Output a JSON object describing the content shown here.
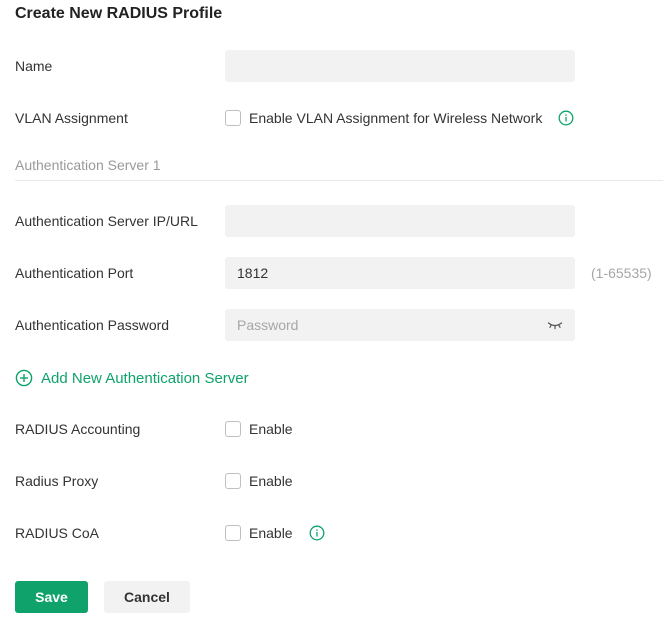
{
  "page": {
    "title": "Create New RADIUS Profile"
  },
  "form": {
    "name": {
      "label": "Name",
      "value": ""
    },
    "vlan": {
      "label": "VLAN Assignment",
      "checkbox_label": "Enable VLAN Assignment for Wireless Network",
      "checked": false
    },
    "section_title": "Authentication Server 1",
    "auth_ip": {
      "label": "Authentication Server IP/URL",
      "value": ""
    },
    "auth_port": {
      "label": "Authentication Port",
      "value": "1812",
      "range_hint": "(1-65535)"
    },
    "auth_password": {
      "label": "Authentication Password",
      "value": "",
      "placeholder": "Password"
    },
    "add_server": {
      "label": "Add New Authentication Server"
    },
    "accounting": {
      "label": "RADIUS Accounting",
      "checkbox_label": "Enable",
      "checked": false
    },
    "proxy": {
      "label": "Radius Proxy",
      "checkbox_label": "Enable",
      "checked": false
    },
    "coa": {
      "label": "RADIUS CoA",
      "checkbox_label": "Enable",
      "checked": false
    }
  },
  "actions": {
    "save_label": "Save",
    "cancel_label": "Cancel"
  },
  "icons": {
    "info": "info-icon",
    "add": "plus-circle-icon",
    "password_toggle": "eye-closed-icon"
  },
  "colors": {
    "accent": "#0fa36b",
    "input_bg": "#f2f2f2",
    "muted_text": "#999999"
  }
}
